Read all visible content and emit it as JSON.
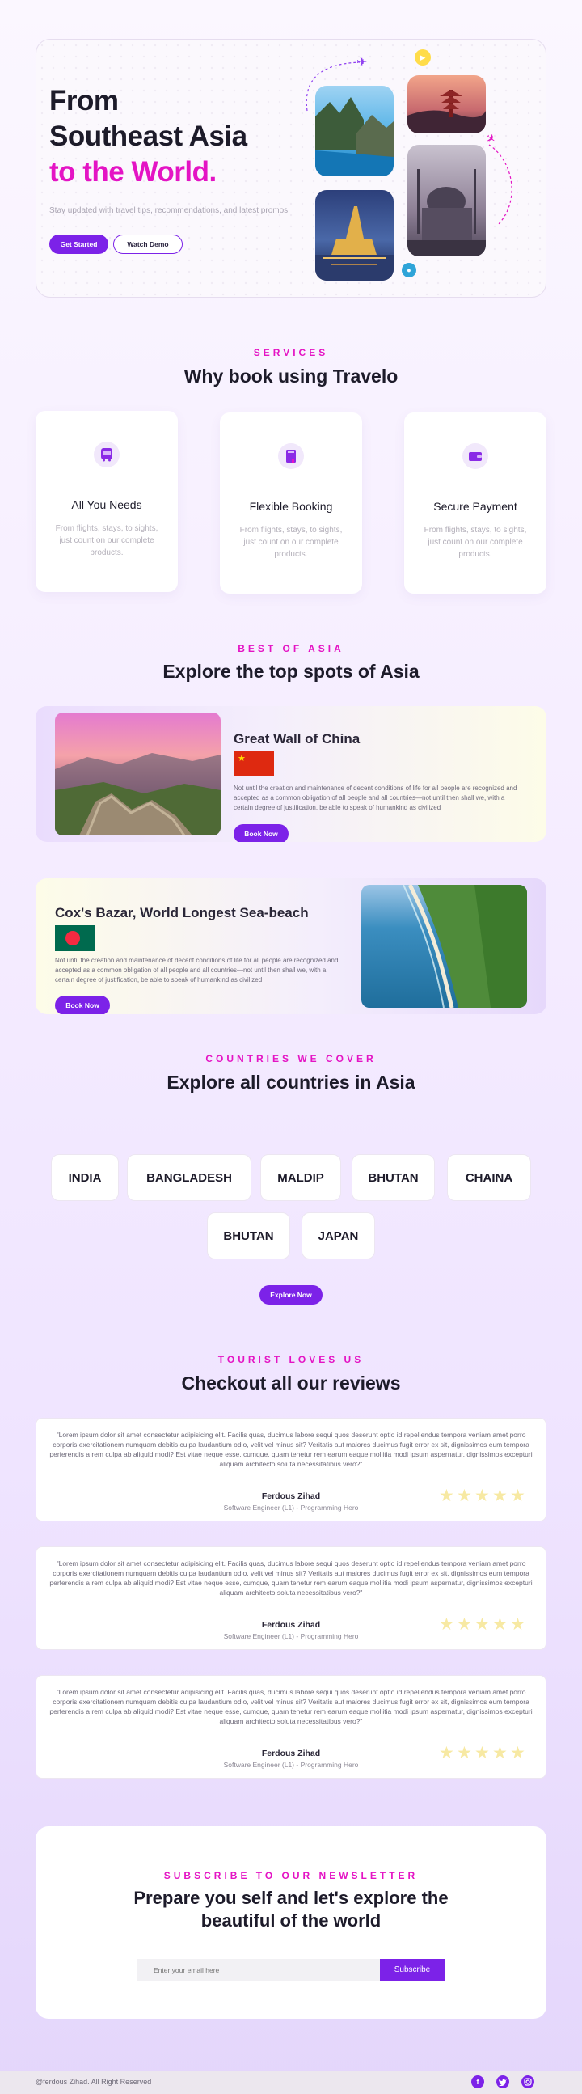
{
  "hero": {
    "title_line1": "From",
    "title_line2": "Southeast Asia",
    "title_line3": "to the World.",
    "subtitle": "Stay updated with travel tips, recommendations, and latest promos.",
    "primary_button": "Get Started",
    "secondary_button": "Watch Demo",
    "accent": "#e414c4",
    "brand": "#7c22e8"
  },
  "services": {
    "kicker": "SERVICES",
    "title": "Why book using Travelo",
    "cards": [
      {
        "title": "All You Needs",
        "text": "From flights, stays, to sights, just count on our complete products.",
        "icon": "bus-icon"
      },
      {
        "title": "Flexible Booking",
        "text": "From flights, stays, to sights, just count on our complete products.",
        "icon": "book-icon"
      },
      {
        "title": "Secure Payment",
        "text": "From flights, stays, to sights, just count on our complete products.",
        "icon": "wallet-icon"
      }
    ]
  },
  "spots": {
    "kicker": "BEST OF ASIA",
    "title": "Explore the top spots of Asia",
    "items": [
      {
        "title": "Great Wall of China",
        "text": "Not until the creation and maintenance of decent conditions of life for all people are recognized and accepted as a common obligation of all people and all countries—not until then shall we, with a certain degree of justification, be able to speak of humankind as civilized",
        "button": "Book Now",
        "flag": "china-flag"
      },
      {
        "title": "Cox's Bazar,  World Longest Sea-beach",
        "text": "Not until the creation and maintenance of decent conditions of life for all people are recognized and accepted as a common obligation of all people and all countries—not until then shall we, with a certain degree of justification, be able to speak of humankind as civilized",
        "button": "Book Now",
        "flag": "bangladesh-flag"
      }
    ]
  },
  "countries": {
    "kicker": "COUNTRIES WE COVER",
    "title": "Explore all  countries in Asia",
    "items": [
      "INDIA",
      "BANGLADESH",
      "MALDIP",
      "BHUTAN",
      "CHAINA",
      "BHUTAN",
      "JAPAN"
    ],
    "button": "Explore Now"
  },
  "reviews": {
    "kicker": "TOURIST LOVES US",
    "title": "Checkout all our reviews",
    "items": [
      {
        "text": "\"Lorem ipsum dolor sit amet consectetur adipisicing elit. Facilis quas, ducimus labore sequi quos deserunt optio id repellendus tempora veniam amet porro corporis exercitationem numquam debitis culpa laudantium odio, velit vel minus sit? Veritatis aut maiores ducimus fugit error ex sit, dignissimos eum tempora perferendis a rem culpa ab aliquid modi? Est vitae neque esse, cumque, quam tenetur rem earum eaque mollitia modi ipsum aspernatur, dignissimos excepturi aliquam architecto soluta necessitatibus vero?\"",
        "name": "Ferdous Zihad",
        "role": "Software Engineer (L1) - Programming Hero",
        "rating": 5
      },
      {
        "text": "\"Lorem ipsum dolor sit amet consectetur adipisicing elit. Facilis quas, ducimus labore sequi quos deserunt optio id repellendus tempora veniam amet porro corporis exercitationem numquam debitis culpa laudantium odio, velit vel minus sit? Veritatis aut maiores ducimus fugit error ex sit, dignissimos eum tempora perferendis a rem culpa ab aliquid modi? Est vitae neque esse, cumque, quam tenetur rem earum eaque mollitia modi ipsum aspernatur, dignissimos excepturi aliquam architecto soluta necessitatibus vero?\"",
        "name": "Ferdous Zihad",
        "role": "Software Engineer (L1) - Programming Hero",
        "rating": 5
      },
      {
        "text": "\"Lorem ipsum dolor sit amet consectetur adipisicing elit. Facilis quas, ducimus labore sequi quos deserunt optio id repellendus tempora veniam amet porro corporis exercitationem numquam debitis culpa laudantium odio, velit vel minus sit? Veritatis aut maiores ducimus fugit error ex sit, dignissimos eum tempora perferendis a rem culpa ab aliquid modi? Est vitae neque esse, cumque, quam tenetur rem earum eaque mollitia modi ipsum aspernatur, dignissimos excepturi aliquam architecto soluta necessitatibus vero?\"",
        "name": "Ferdous Zihad",
        "role": "Software Engineer (L1) - Programming Hero",
        "rating": 5
      }
    ]
  },
  "newsletter": {
    "kicker": "SUBSCRIBE TO OUR NEWSLETTER",
    "title_line1": "Prepare you self and let's explore the",
    "title_line2": "beautiful of the world",
    "placeholder": "Enter your email here",
    "button": "Subscribe"
  },
  "footer": {
    "copyright": "@ferdous Zihad. All Right Reserved",
    "social_icons": [
      "facebook-icon",
      "twitter-icon",
      "instagram-icon"
    ]
  }
}
